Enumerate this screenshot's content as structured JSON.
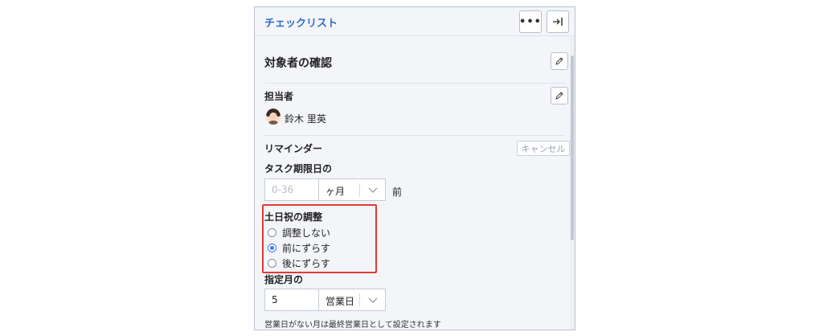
{
  "header": {
    "title": "チェックリスト",
    "more_icon": "more-horizontal-icon",
    "collapse_icon": "collapse-right-icon"
  },
  "target_section": {
    "title": "対象者の確認",
    "edit_icon": "pencil-icon"
  },
  "assignee": {
    "title": "担当者",
    "edit_icon": "pencil-icon",
    "name": "鈴木 里英"
  },
  "reminder": {
    "title": "リマインダー",
    "cancel_label": "キャンセル",
    "deadline_label": "タスク期限日の",
    "number_placeholder": "0-36",
    "unit_value": "ヶ月",
    "before_label": "前"
  },
  "holiday_adjust": {
    "title": "土日祝の調整",
    "options": [
      {
        "label": "調整しない",
        "checked": false
      },
      {
        "label": "前にずらす",
        "checked": true
      },
      {
        "label": "後にずらす",
        "checked": false
      }
    ]
  },
  "specified_month": {
    "label": "指定月の",
    "number_value": "5",
    "unit_value": "営業日"
  },
  "note": "営業日がない月は最終営業日として設定されます",
  "colors": {
    "accent": "#2f6fd0",
    "highlight": "#e53935",
    "radio_checked": "#3b7be0"
  }
}
